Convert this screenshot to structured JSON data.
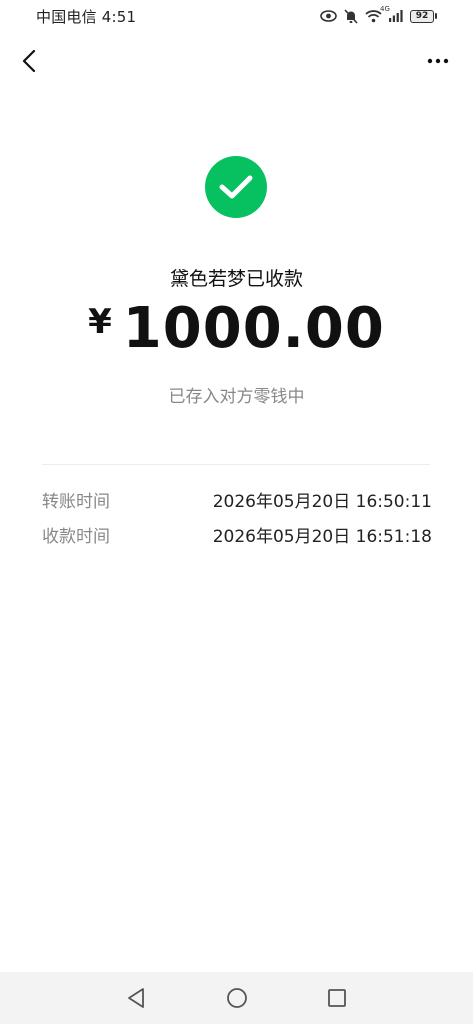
{
  "status_bar": {
    "carrier": "中国电信",
    "time": "4:51",
    "network": "4G",
    "battery": "92"
  },
  "nav": {
    "back_icon": "chevron-left-icon",
    "more_icon": "more-dots-icon"
  },
  "receipt": {
    "icon": "check-circle-icon",
    "title": "黛色若梦已收款",
    "currency": "¥",
    "amount": "1000.00",
    "note": "已存入对方零钱中"
  },
  "details": [
    {
      "label": "转账时间",
      "value": "2026年05月20日 16:50:11"
    },
    {
      "label": "收款时间",
      "value": "2026年05月20日 16:51:18"
    }
  ],
  "colors": {
    "success": "#07c160",
    "label_gray": "#888888"
  },
  "system_nav": {
    "back_icon": "triangle-back-icon",
    "home_icon": "circle-home-icon",
    "recent_icon": "square-recents-icon"
  }
}
